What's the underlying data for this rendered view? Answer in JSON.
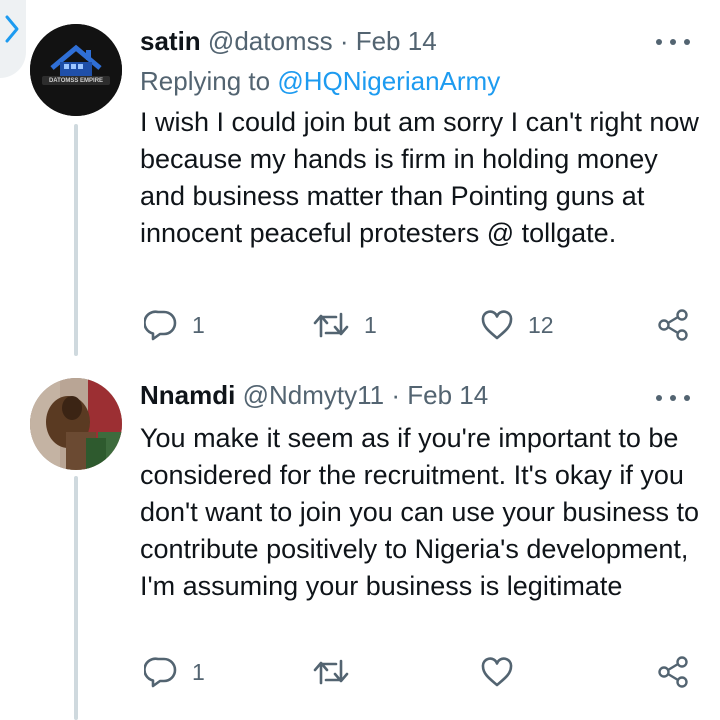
{
  "tweets": [
    {
      "display_name": "satin",
      "handle": "@datomss",
      "separator": "·",
      "date": "Feb 14",
      "replying_label": "Replying to",
      "replying_to": "@HQNigerianArmy",
      "avatar_text": "DATOMSS EMPIRE",
      "text": "I wish I could join but am sorry I can't right now because my hands is firm in holding money and business matter than Pointing guns at innocent peaceful protesters @ tollgate.",
      "reply_count": "1",
      "retweet_count": "1",
      "like_count": "12"
    },
    {
      "display_name": "Nnamdi",
      "handle": "@Ndmyty11",
      "separator": "·",
      "date": "Feb 14",
      "text": "You make it seem as if you're important to be considered for the recruitment. It's okay if you don't want to join you can use your business to contribute positively to Nigeria's development, I'm assuming your business is legitimate",
      "reply_count": "1",
      "retweet_count": "",
      "like_count": ""
    }
  ],
  "colors": {
    "text": "#0f1419",
    "secondary": "#536471",
    "link": "#1d9bf0",
    "thread_line": "#cfd9de"
  },
  "icons": [
    "back-chevron-icon",
    "more-icon",
    "reply-icon",
    "retweet-icon",
    "like-icon",
    "share-icon"
  ]
}
